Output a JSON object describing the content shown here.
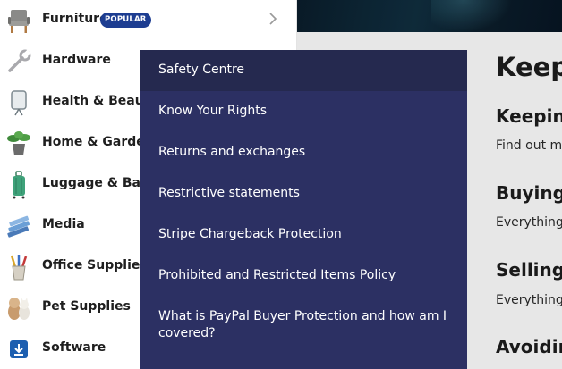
{
  "categories": [
    {
      "label": "Furniture",
      "badge": "POPULAR",
      "icon": "chair-icon"
    },
    {
      "label": "Hardware",
      "icon": "wrench-icon"
    },
    {
      "label": "Health & Beauty",
      "icon": "mirror-icon"
    },
    {
      "label": "Home & Garden",
      "icon": "potted-plant-icon"
    },
    {
      "label": "Luggage & Bags",
      "icon": "suitcase-icon"
    },
    {
      "label": "Media",
      "icon": "books-icon"
    },
    {
      "label": "Office Supplies &",
      "icon": "pencil-cup-icon"
    },
    {
      "label": "Pet Supplies",
      "icon": "dog-cat-icon"
    },
    {
      "label": "Software",
      "icon": "download-icon"
    }
  ],
  "flyout": {
    "items": [
      {
        "label": "Safety Centre"
      },
      {
        "label": "Know Your Rights"
      },
      {
        "label": "Returns and exchanges"
      },
      {
        "label": "Restrictive statements"
      },
      {
        "label": "Stripe Chargeback Protection"
      },
      {
        "label": "Prohibited and Restricted Items Policy"
      },
      {
        "label": "What is PayPal Buyer Protection and how am I covered?"
      }
    ]
  },
  "page": {
    "heading": "Keepi",
    "sections": [
      {
        "title": "Keeping",
        "text": "Find out m"
      },
      {
        "title": "Buying v",
        "text": "Everything"
      },
      {
        "title": "Selling s",
        "text": "Everything"
      },
      {
        "title": "Avoidin"
      }
    ]
  },
  "colors": {
    "flyout_bg": "#2c3063",
    "flyout_active_bg": "#25294f",
    "badge_bg": "#1d3d91"
  }
}
